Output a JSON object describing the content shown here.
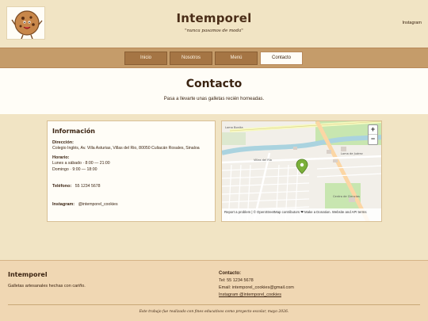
{
  "header": {
    "title": "Intemporel",
    "subtitle": "\"nunca pasamos de moda\"",
    "instagram_link": "Instagram"
  },
  "nav": {
    "items": [
      "Inicio",
      "Nosotros",
      "Menú",
      "Contacto"
    ],
    "active": "Contacto"
  },
  "hero": {
    "title": "Contacto",
    "text": "Pasa a llevarte unas galletas recién horneadas."
  },
  "info": {
    "heading": "Información",
    "address_label": "Dirección:",
    "address_value": "Colegio Inglés, Av. Villa Asturias, Villas del Rio, 80050 Culiacán Rosales, Sinaloa",
    "hours_label": "Horario:",
    "hours_weekday": "Lunes a sábado · 8:00 — 21:00",
    "hours_sunday": "Domingo · 9:00 — 18:00",
    "phone_label": "Teléfono:",
    "phone_value": "55 1234 5678",
    "instagram_label": "Instagram:",
    "instagram_value": "@intemporel_cookies"
  },
  "map": {
    "zoom_in": "+",
    "zoom_out": "−",
    "attribution": "Report a problem | © OpenStreetMap contributors ❤ Make a Donation. Website and API terms",
    "labels": [
      "Loma Bonita",
      "Villas del Río",
      "Loma de Juárez",
      "Centro de Ciencias"
    ]
  },
  "footer": {
    "brand": "Intemporel",
    "tagline": "Galletas artesanales hechas con cariño.",
    "contact_title": "Contacto:",
    "phone": "Tel: 55 1234 5678",
    "email": "Email: intemporel_cookies@gmail.com",
    "instagram": "Instagram @intemporel_cookies",
    "note": "Este trabajo fue realizado con fines educativos como proyecto escolar, mayo 2026."
  },
  "colors": {
    "background": "#f1e4c4",
    "nav_bar": "#c59c6a",
    "nav_button": "#a57544",
    "text": "#3b2412",
    "map_pin": "#7bb03a"
  }
}
